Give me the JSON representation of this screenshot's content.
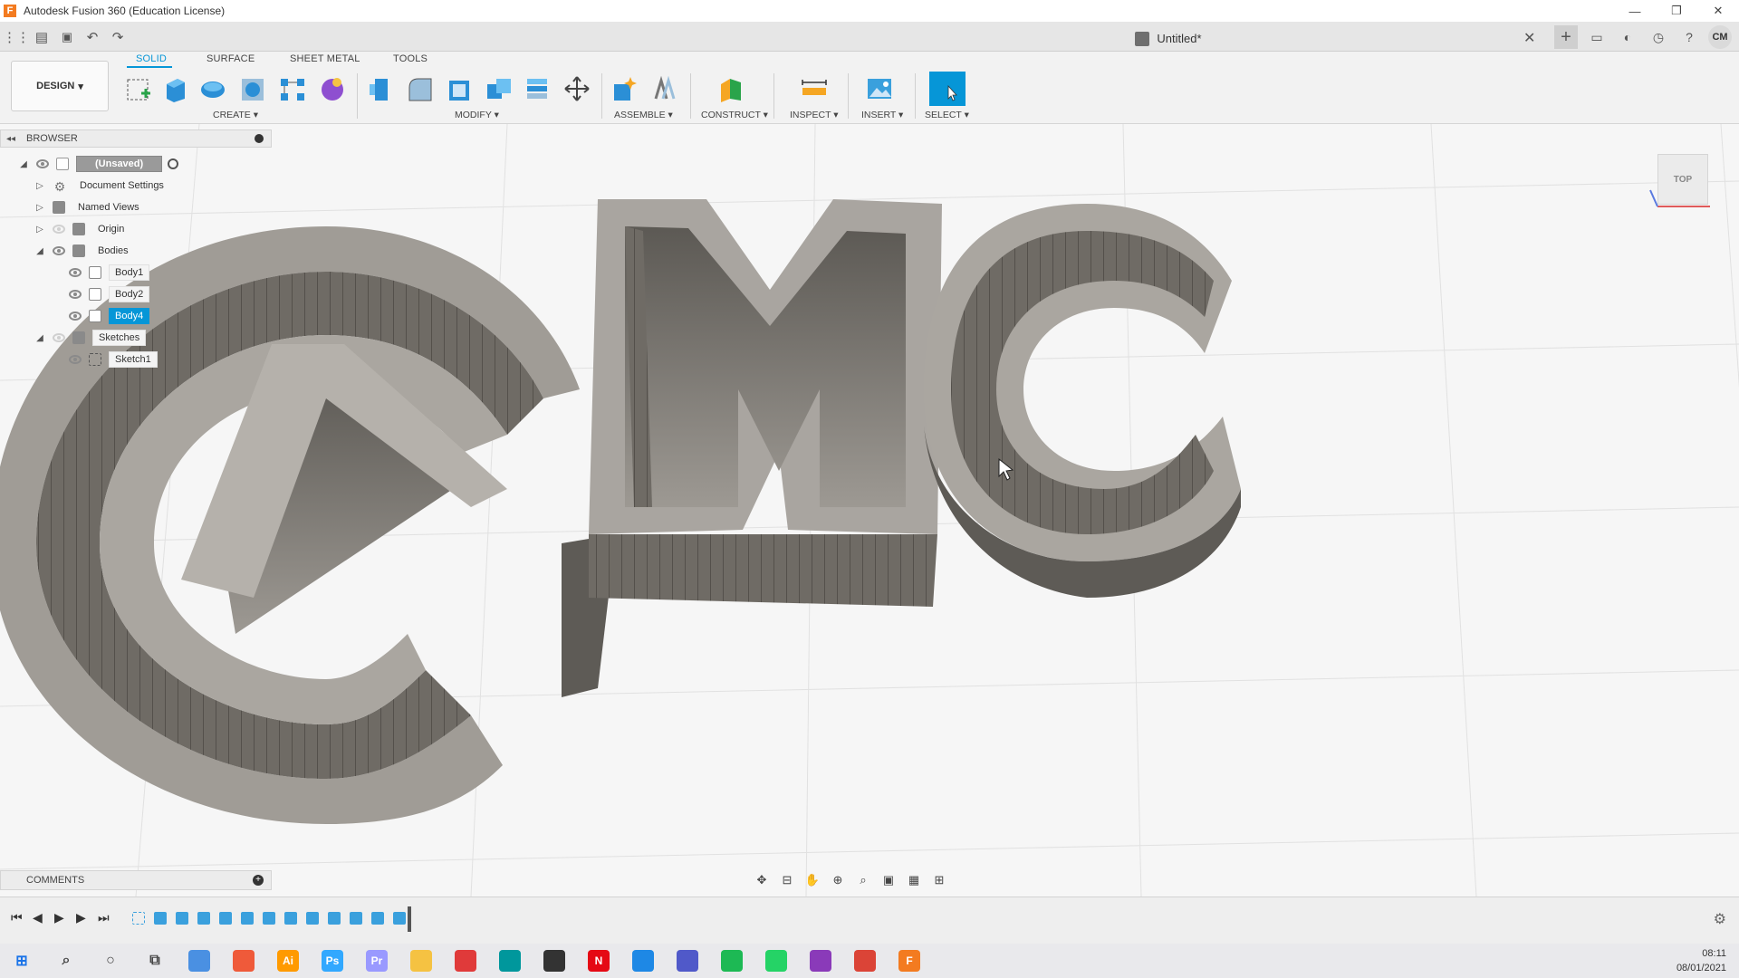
{
  "window": {
    "title": "Autodesk Fusion 360 (Education License)",
    "logo_letter": "F",
    "minimize": "—",
    "restore": "❐",
    "close": "✕"
  },
  "quick_access": {
    "grid_icon": "⋮⋮",
    "file_icon": "▤",
    "save_icon": "💾",
    "undo_icon": "↶",
    "redo_icon": "↷"
  },
  "document": {
    "name": "Untitled*",
    "close_icon": "✕"
  },
  "right_toolbar": {
    "plus": "+",
    "user_initials": "CM"
  },
  "ribbon": {
    "tabs": [
      "SOLID",
      "SURFACE",
      "SHEET METAL",
      "TOOLS"
    ],
    "active_tab": "SOLID",
    "workspace": "DESIGN",
    "groups": [
      "CREATE",
      "MODIFY",
      "ASSEMBLE",
      "CONSTRUCT",
      "INSPECT",
      "INSERT",
      "SELECT"
    ]
  },
  "browser": {
    "title": "BROWSER",
    "items": [
      {
        "label": "(Unsaved)"
      },
      {
        "label": "Document Settings"
      },
      {
        "label": "Named Views"
      },
      {
        "label": "Origin"
      },
      {
        "label": "Bodies"
      },
      {
        "label": "Body1"
      },
      {
        "label": "Body2"
      },
      {
        "label": "Body4"
      },
      {
        "label": "Sketches"
      },
      {
        "label": "Sketch1"
      }
    ],
    "selected": "Body4"
  },
  "viewcube": {
    "face": "TOP"
  },
  "comments": {
    "title": "COMMENTS",
    "plus": "+"
  },
  "taskbar": {
    "time": "08:11",
    "date": "08/01/2021",
    "apps": [
      {
        "name": "windows",
        "color": "#1a73e8"
      },
      {
        "name": "search",
        "color": "#444444"
      },
      {
        "name": "cortana",
        "color": "#444444"
      },
      {
        "name": "task-view",
        "color": "#444444"
      },
      {
        "name": "chrome-alt",
        "color": "#4a90e2"
      },
      {
        "name": "app-c",
        "color": "#ef5a3a"
      },
      {
        "name": "illustrator",
        "color": "#ff9a00"
      },
      {
        "name": "photoshop",
        "color": "#31a8ff"
      },
      {
        "name": "premiere",
        "color": "#9999ff"
      },
      {
        "name": "explorer",
        "color": "#f5c242"
      },
      {
        "name": "app-red",
        "color": "#e03a3a"
      },
      {
        "name": "arduino",
        "color": "#00979c"
      },
      {
        "name": "store",
        "color": "#333333"
      },
      {
        "name": "netflix",
        "color": "#e50914"
      },
      {
        "name": "mail",
        "color": "#1e88e5"
      },
      {
        "name": "teams",
        "color": "#5059c9"
      },
      {
        "name": "spotify",
        "color": "#1db954"
      },
      {
        "name": "whatsapp",
        "color": "#25d366"
      },
      {
        "name": "instagram",
        "color": "#8a3ab9"
      },
      {
        "name": "chrome",
        "color": "#db4437"
      },
      {
        "name": "fusion",
        "color": "#f37b20"
      }
    ],
    "labels": {
      "illustrator": "Ai",
      "photoshop": "Ps",
      "premiere": "Pr",
      "netflix": "N",
      "fusion": "F"
    }
  },
  "colors": {
    "accent": "#0696d7",
    "fusion_orange": "#f37b20"
  }
}
